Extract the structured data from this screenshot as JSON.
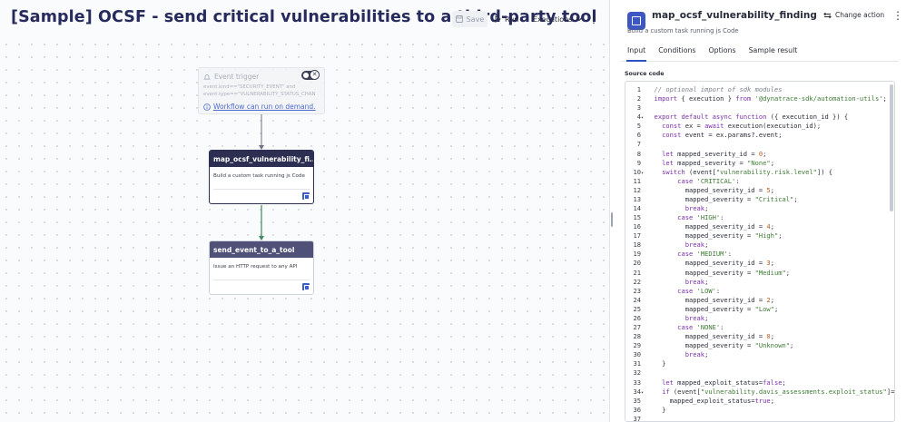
{
  "header": {
    "title": "[Sample] OCSF - send critical vulnerabilities to a third-party tool",
    "save_label": "Save",
    "run_label": "Run",
    "executions_label": "Executions"
  },
  "workflow": {
    "trigger": {
      "title": "Event trigger",
      "condition_line1": "event.kind==\"SECURITY_EVENT\" and",
      "condition_line2": "event.type==\"VULNERABILITY_STATUS_CHAN",
      "on_demand": "Workflow can run on demand."
    },
    "tasks": [
      {
        "name": "map_ocsf_vulnerability_fi...",
        "description": "Build a custom task running js Code"
      },
      {
        "name": "send_event_to_a_tool",
        "description": "Issue an HTTP request to any API"
      }
    ]
  },
  "panel": {
    "task_name": "map_ocsf_vulnerability_finding",
    "task_description": "Build a custom task running js Code",
    "change_action_label": "Change action",
    "tabs": [
      "Input",
      "Conditions",
      "Options",
      "Sample result"
    ],
    "active_tab": "Input",
    "source_code_label": "Source code"
  },
  "code": {
    "lines": [
      "  // optional import of sdk modules",
      "  import { execution } from '@dynatrace-sdk/automation-utils';",
      "",
      "  export default async function ({ execution_id }) {",
      "    const ex = await execution(execution_id);",
      "    const event = ex.params?.event;",
      "",
      "    let mapped_severity_id = 0;",
      "    let mapped_severity = \"None\";",
      "    switch (event[\"vulnerability.risk.level\"]) {",
      "        case 'CRITICAL':",
      "          mapped_severity_id = 5;",
      "          mapped_severity = \"Critical\";",
      "          break;",
      "        case 'HIGH':",
      "          mapped_severity_id = 4;",
      "          mapped_severity = \"High\";",
      "          break;",
      "        case 'MEDIUM':",
      "          mapped_severity_id = 3;",
      "          mapped_severity = \"Medium\";",
      "          break;",
      "        case 'LOW':",
      "          mapped_severity_id = 2;",
      "          mapped_severity = \"Low\";",
      "          break;",
      "        case 'NONE':",
      "          mapped_severity_id = 0;",
      "          mapped_severity = \"Unknown\";",
      "          break;",
      "    }",
      "",
      "    let mapped_exploit_status=false;",
      "    if (event[\"vulnerability.davis_assessments.exploit_status\"]=",
      "      mapped_exploit_status=true;",
      "    }",
      ""
    ],
    "fold_lines": [
      4,
      10,
      34
    ]
  },
  "colors": {
    "title": "#272b5c",
    "task_active": "#2c2f52",
    "task_inactive": "#4f5178",
    "accent": "#2f52c3",
    "connector": "#3d8a5c"
  }
}
